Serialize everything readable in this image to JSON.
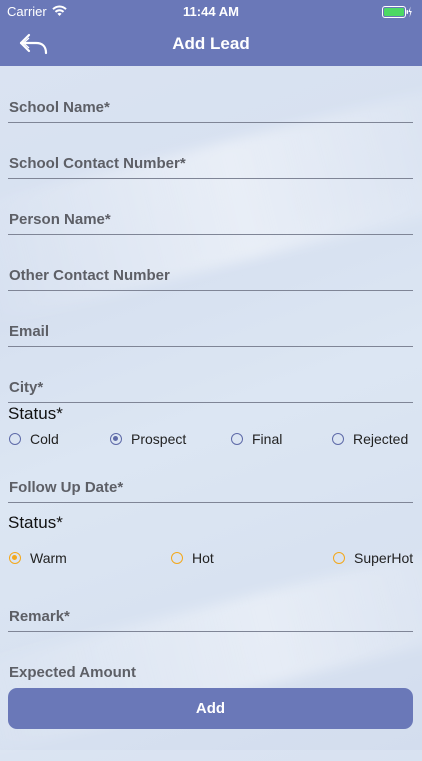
{
  "status_bar": {
    "carrier": "Carrier",
    "time": "11:44 AM"
  },
  "navbar": {
    "title": "Add Lead"
  },
  "fields": {
    "school_name": "School Name*",
    "school_contact": "School Contact Number*",
    "person_name": "Person Name*",
    "other_contact": "Other Contact Number",
    "email": "Email",
    "city": "City*",
    "follow_up_date": "Follow Up Date*",
    "remark": "Remark*",
    "expected_amount": "Expected Amount"
  },
  "status_section": {
    "title": "Status*",
    "options": [
      "Cold",
      "Prospect",
      "Final",
      "Rejected"
    ],
    "selected": "Prospect"
  },
  "temperature_section": {
    "title": "Status*",
    "options": [
      "Warm",
      "Hot",
      "SuperHot"
    ],
    "selected": "Warm"
  },
  "add_button": {
    "label": "Add"
  },
  "colors": {
    "primary": "#6a78b8",
    "radio_blue": "#5e6aa8",
    "radio_orange": "#f3a81c"
  }
}
